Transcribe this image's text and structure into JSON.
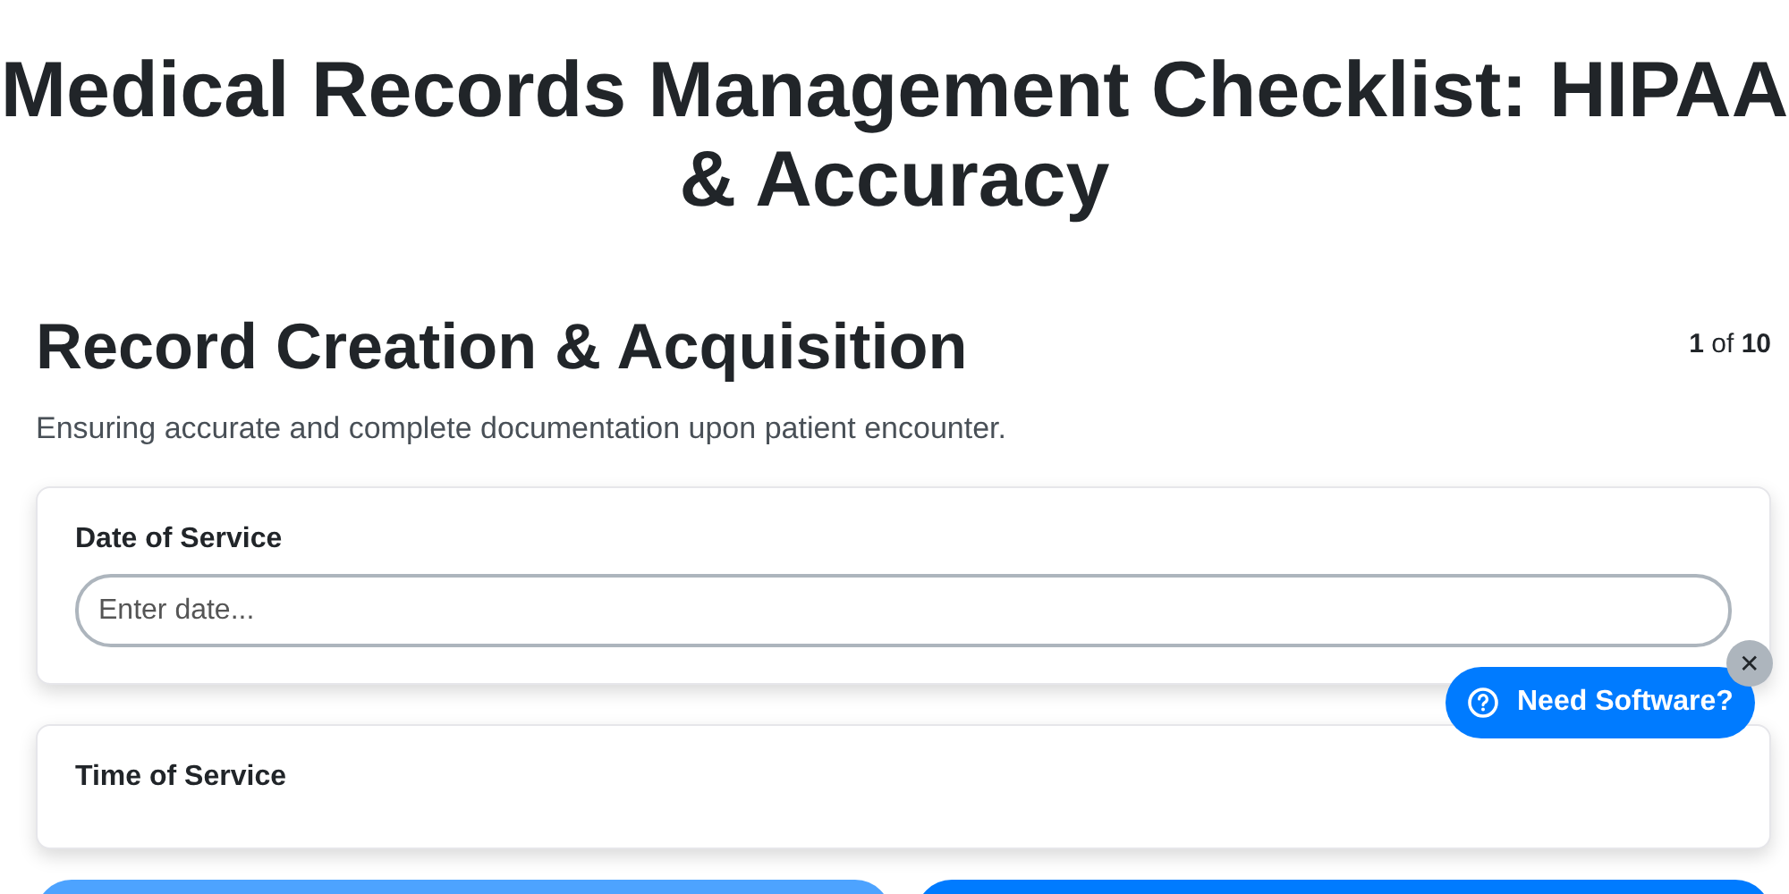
{
  "title": "Medical Records Management Checklist: HIPAA & Accuracy",
  "section": {
    "heading": "Record Creation & Acquisition",
    "counter": "**1** of **10**",
    "description": "Ensuring accurate and complete documentation upon patient encounter."
  },
  "fields": [
    {
      "label": "Date of Service",
      "kind": "text",
      "placeholder": "Enter date..."
    },
    {
      "label": "Time of Service",
      "kind": "label-only"
    }
  ],
  "nav_buttons": [
    {
      "disabled": true
    },
    {
      "disabled": false
    }
  ],
  "help_widget": {
    "label": "Need Software?",
    "close": "✕"
  }
}
